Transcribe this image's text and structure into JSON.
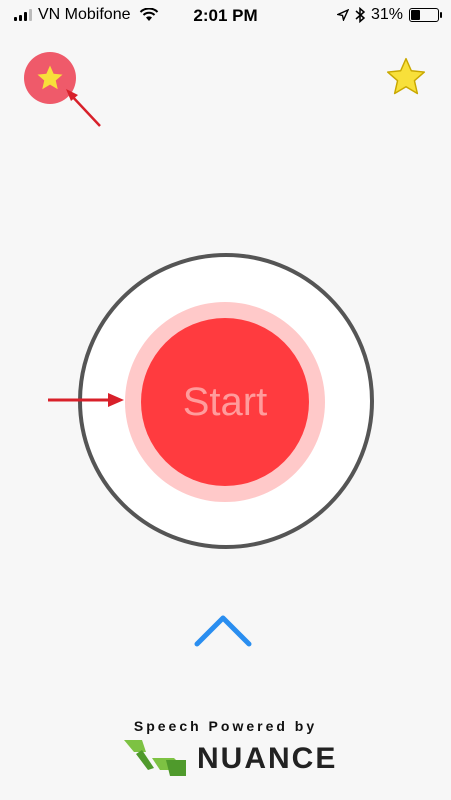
{
  "status_bar": {
    "carrier": "VN Mobifone",
    "time": "2:01 PM",
    "battery_percent": "31%",
    "battery_level": 0.31,
    "icons": [
      "signal-icon",
      "wifi-icon",
      "location-icon",
      "bluetooth-icon",
      "battery-icon"
    ]
  },
  "toolbar": {
    "favorites_icon": "star-icon",
    "favorites_button_color": "#ef5a6a",
    "star_outline_icon": "star-outline-icon",
    "star_outline_color": "#f8e03a"
  },
  "main": {
    "start_label": "Start",
    "start_color": "#ff3b3f",
    "halo_color": "#ffc9c9",
    "expand_icon": "chevron-up-icon",
    "accent_color": "#2a8ef0"
  },
  "footer": {
    "caption": "Speech Powered by",
    "brand": "NUANCE",
    "logo_color": "#7dc243"
  }
}
